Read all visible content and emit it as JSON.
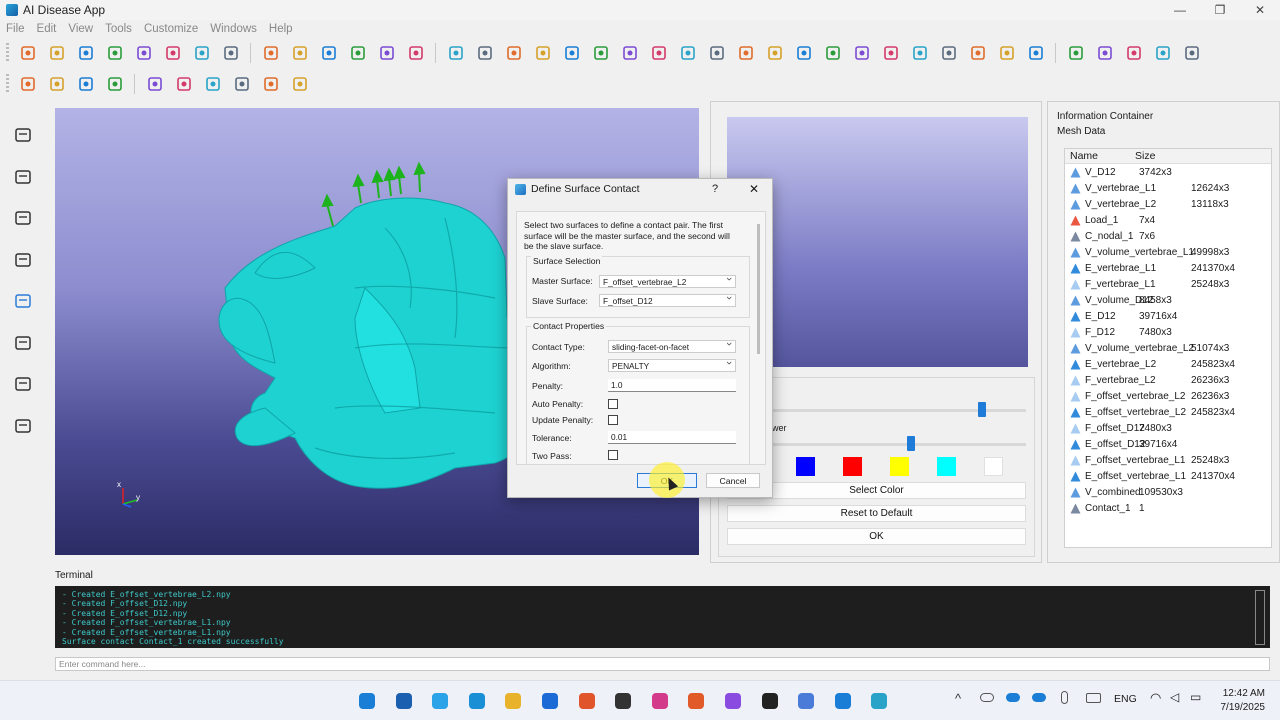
{
  "app": {
    "title": "AI Disease App"
  },
  "window_controls": {
    "minimize": "—",
    "maximize": "❐",
    "close": "✕"
  },
  "menu": [
    "File",
    "Edit",
    "View",
    "Tools",
    "Customize",
    "Windows",
    "Help"
  ],
  "toolbar_row1": [
    "new-file-icon",
    "open-folder-icon",
    "save-stl-icon",
    "save-ste-icon",
    "save-icon",
    "save-grid-icon",
    "export-feb-icon",
    "export-chart-icon",
    "sphere-view-icon",
    "head-model-icon",
    "grid-view-icon",
    "swap-icon",
    "person-icon",
    "person-alt-icon",
    "curve-icon",
    "mesh-ball-icon",
    "orange-sphere-icon",
    "textured-sphere-icon",
    "gray-sphere-icon",
    "folder-tool-icon",
    "crop-icon",
    "link-icon",
    "layers-icon",
    "cube-mesh-icon",
    "play-icon",
    "pin-icon",
    "scissors-icon",
    "node-icon",
    "node-alt-icon",
    "node-alt2-icon",
    "blue-cube-icon",
    "gray-cube-icon",
    "panel-icon",
    "color-wheel-icon",
    "chart-edit-icon",
    "line-icon",
    "circle-icon",
    "arc-icon",
    "box-icon",
    "ellipse-icon"
  ],
  "toolbar_row2": [
    "point-select-icon",
    "hex-icon",
    "wire-cube-icon",
    "color-cube-icon",
    "add-node-icon",
    "add-link-icon",
    "arrows-icon",
    "pyramid-icon",
    "crosshair-icon",
    "arrow-split-icon"
  ],
  "left_sidebar": [
    "import-icon",
    "person-model-icon",
    "list-icon",
    "document-icon",
    "ai-icon",
    "profile-icon",
    "eraser-icon",
    "settings-icon"
  ],
  "preview_panel": {
    "label_fragment": "wer",
    "slider1_value": 0.83,
    "slider2_value": 0.55,
    "swatches": [
      "#0000ff",
      "#ff0000",
      "#ffff00",
      "#00ffff",
      "#ffffff"
    ],
    "select_color": "Select Color",
    "reset_default": "Reset to Default",
    "ok": "OK"
  },
  "info": {
    "title": "Information Container",
    "subtitle": "Mesh Data",
    "columns": {
      "name": "Name",
      "size": "Size"
    },
    "items": [
      {
        "name": "V_D12",
        "size": "3742x3",
        "icon": "#4a90d9"
      },
      {
        "name": "V_vertebrae_L1",
        "size": "12624x3",
        "icon": "#4a90d9"
      },
      {
        "name": "V_vertebrae_L2",
        "size": "13118x3",
        "icon": "#4a90d9"
      },
      {
        "name": "Load_1",
        "size": "7x4",
        "icon": "#e8452c"
      },
      {
        "name": "C_nodal_1",
        "size": "7x6",
        "icon": "#6d7c96"
      },
      {
        "name": "V_volume_vertebrae_L1",
        "size": "49998x3",
        "icon": "#4a90d9"
      },
      {
        "name": "E_vertebrae_L1",
        "size": "241370x4",
        "icon": "#1b7ed6"
      },
      {
        "name": "F_vertebrae_L1",
        "size": "25248x3",
        "icon": "#9cc8ef"
      },
      {
        "name": "V_volume_D12",
        "size": "8458x3",
        "icon": "#4a90d9"
      },
      {
        "name": "E_D12",
        "size": "39716x4",
        "icon": "#1b7ed6"
      },
      {
        "name": "F_D12",
        "size": "7480x3",
        "icon": "#9cc8ef"
      },
      {
        "name": "V_volume_vertebrae_L2",
        "size": "51074x3",
        "icon": "#4a90d9"
      },
      {
        "name": "E_vertebrae_L2",
        "size": "245823x4",
        "icon": "#1b7ed6"
      },
      {
        "name": "F_vertebrae_L2",
        "size": "26236x3",
        "icon": "#9cc8ef"
      },
      {
        "name": "F_offset_vertebrae_L2",
        "size": "26236x3",
        "icon": "#9cc8ef"
      },
      {
        "name": "E_offset_vertebrae_L2",
        "size": "245823x4",
        "icon": "#1b7ed6"
      },
      {
        "name": "F_offset_D12",
        "size": "7480x3",
        "icon": "#9cc8ef"
      },
      {
        "name": "E_offset_D12",
        "size": "39716x4",
        "icon": "#1b7ed6"
      },
      {
        "name": "F_offset_vertebrae_L1",
        "size": "25248x3",
        "icon": "#9cc8ef"
      },
      {
        "name": "E_offset_vertebrae_L1",
        "size": "241370x4",
        "icon": "#1b7ed6"
      },
      {
        "name": "V_combined",
        "size": "109530x3",
        "icon": "#4a90d9"
      },
      {
        "name": "Contact_1",
        "size": "1",
        "icon": "#6d7c96"
      }
    ]
  },
  "terminal": {
    "title": "Terminal",
    "lines": [
      "- Created E_offset_vertebrae_L2.npy",
      "- Created F_offset_D12.npy",
      "- Created E_offset_D12.npy",
      "- Created F_offset_vertebrae_L1.npy",
      "- Created E_offset_vertebrae_L1.npy",
      "Surface contact Contact_1 created successfully"
    ],
    "placeholder": "Enter command here..."
  },
  "axes": {
    "x": "x",
    "y": "y"
  },
  "dialog": {
    "title": "Define Surface Contact",
    "help": "?",
    "close": "✕",
    "description": "Select two surfaces to define a contact pair. The first surface will be the master surface, and the second will be the slave surface.",
    "surface_selection": "Surface Selection",
    "master_label": "Master Surface:",
    "master_value": "F_offset_vertebrae_L2",
    "slave_label": "Slave Surface:",
    "slave_value": "F_offset_D12",
    "contact_properties": "Contact Properties",
    "contact_type_label": "Contact Type:",
    "contact_type_value": "sliding-facet-on-facet",
    "algorithm_label": "Algorithm:",
    "algorithm_value": "PENALTY",
    "penalty_label": "Penalty:",
    "penalty_value": "1.0",
    "auto_penalty_label": "Auto Penalty:",
    "update_penalty_label": "Update Penalty:",
    "tolerance_label": "Tolerance:",
    "tolerance_value": "0.01",
    "two_pass_label": "Two Pass:",
    "ok": "OK",
    "cancel": "Cancel"
  },
  "taskbar": {
    "apps": [
      "windows-start-icon",
      "search-icon",
      "telegram-icon",
      "edge-icon",
      "file-explorer-icon",
      "outlook-icon",
      "matlab-icon",
      "app-icon",
      "snipping-icon",
      "brave-icon",
      "copilot-icon",
      "chatgpt-icon",
      "gemini-icon",
      "vscode-icon",
      "ai-disease-app-icon"
    ],
    "tray_lang": "ENG",
    "time": "12:42 AM",
    "date": "7/19/2025"
  }
}
